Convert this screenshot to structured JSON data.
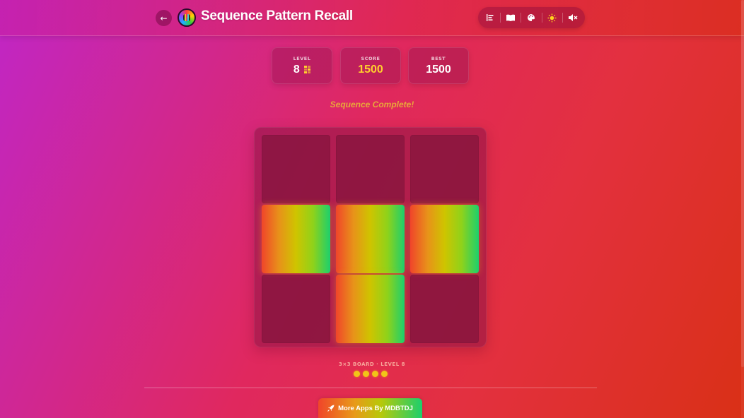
{
  "app": {
    "title": "Sequence Pattern Recall"
  },
  "header": {
    "back_icon": "arrow-left-icon",
    "logo_icon": "app-logo-icon",
    "toolbar": [
      {
        "icon": "leaderboard-icon",
        "glyph": "☰"
      },
      {
        "icon": "book-icon",
        "glyph": "📖"
      },
      {
        "icon": "palette-icon",
        "glyph": "🎨"
      },
      {
        "icon": "sun-icon",
        "glyph": "✹"
      },
      {
        "icon": "mute-icon",
        "glyph": "🔇"
      }
    ]
  },
  "stats": {
    "level_label": "LEVEL",
    "level_value": "8",
    "score_label": "SCORE",
    "score_value": "1500",
    "best_label": "BEST",
    "best_value": "1500"
  },
  "status_text": "Sequence Complete!",
  "board": {
    "rows": 3,
    "cols": 3,
    "tiles": [
      false,
      false,
      false,
      true,
      true,
      true,
      false,
      true,
      false
    ],
    "info": "3×3 BOARD · LEVEL 8",
    "progress_dots": 4
  },
  "footer": {
    "more_apps_label": "More Apps By MDBTDJ",
    "rocket_icon": "rocket-icon"
  },
  "colors": {
    "accent_gold": "#ffcf2e",
    "status_text": "#e8a63a",
    "lit_tile_start": "#f0452a",
    "lit_tile_mid": "#cfc400",
    "lit_tile_end": "#1ccf6d"
  }
}
